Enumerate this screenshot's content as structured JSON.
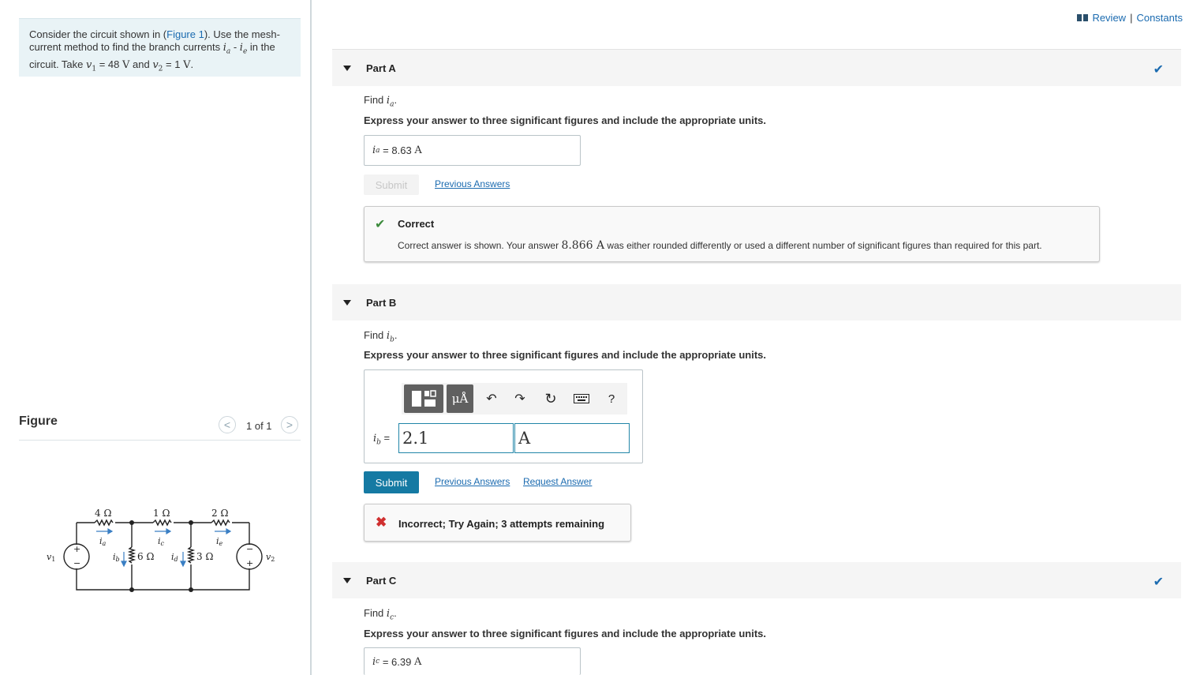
{
  "problem": {
    "pre": "Consider the circuit shown in (",
    "figure_link": "Figure 1",
    "mid1": "). Use the mesh-current method to find the branch currents ",
    "ia": "i",
    "ia_sub": "a",
    "dash": " - ",
    "ie": "i",
    "ie_sub": "e",
    "mid2": " in the circuit. Take ",
    "v1": "v",
    "v1_sub": "1",
    "v1_val": " = 48 ",
    "v1_unit": "V",
    "and": " and ",
    "v2": "v",
    "v2_sub": "2",
    "v2_val": " = 1 ",
    "v2_unit": "V",
    "end": "."
  },
  "figure": {
    "title": "Figure",
    "pager": "1 of 1",
    "prev": "<",
    "next": ">",
    "circuit": {
      "r4": "4 Ω",
      "r1": "1 Ω",
      "r2": "2 Ω",
      "r6": "6 Ω",
      "r3": "3 Ω",
      "ia": "i",
      "ia_s": "a",
      "ic": "i",
      "ic_s": "c",
      "ie": "i",
      "ie_s": "e",
      "ib": "i",
      "ib_s": "b",
      "id": "i",
      "id_s": "d",
      "v1": "v",
      "v1_s": "1",
      "v2": "v",
      "v2_s": "2",
      "plus": "+",
      "minus": "−"
    }
  },
  "header": {
    "review": "Review",
    "sep": " | ",
    "constants": "Constants"
  },
  "partA": {
    "title": "Part A",
    "find": "Find ",
    "var": "i",
    "var_sub": "a",
    "find_end": ".",
    "instr": "Express your answer to three significant figures and include the appropriate units.",
    "answer_var": "i",
    "answer_sub": "a",
    "answer_eq": " = ",
    "answer_val": "8.63",
    "answer_unit": "A",
    "submit": "Submit",
    "prev_answers": "Previous Answers",
    "fb_title": "Correct",
    "fb_pre": "Correct answer is shown. Your answer ",
    "fb_val": "8.866 A",
    "fb_post": " was either rounded differently or used a different number of significant figures than required for this part."
  },
  "partB": {
    "title": "Part B",
    "find": "Find ",
    "var": "i",
    "var_sub": "b",
    "find_end": ".",
    "instr": "Express your answer to three significant figures and include the appropriate units.",
    "tool_unit": "μÅ",
    "tool_help": "?",
    "label_var": "i",
    "label_sub": "b",
    "label_eq": " =",
    "value": "2.1",
    "unit": "A",
    "submit": "Submit",
    "prev_answers": "Previous Answers",
    "request": "Request Answer",
    "fb": "Incorrect; Try Again; 3 attempts remaining"
  },
  "partC": {
    "title": "Part C",
    "find": "Find ",
    "var": "i",
    "var_sub": "c",
    "find_end": ".",
    "instr": "Express your answer to three significant figures and include the appropriate units.",
    "answer_var": "i",
    "answer_sub": "c",
    "answer_eq": " = ",
    "answer_val": "6.39",
    "answer_unit": "A"
  },
  "icons": {
    "check": "check-icon",
    "x": "x-icon",
    "undo": "undo-icon",
    "redo": "redo-icon",
    "reset": "reset-icon",
    "keyboard": "keyboard-icon",
    "templates": "templates-icon"
  },
  "colors": {
    "link": "#1b6bb0",
    "correct": "#3c8b3c",
    "incorrect": "#d03030",
    "submit": "#157aa3",
    "problem_bg": "#e9f3f6"
  }
}
